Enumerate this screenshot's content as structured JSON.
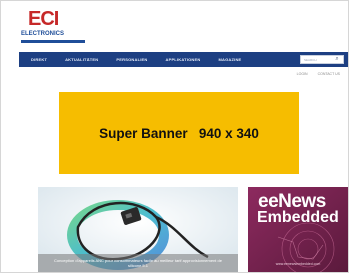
{
  "header": {
    "logo_main": "ECI",
    "logo_sub": "ELECTRONICS"
  },
  "nav": {
    "items": [
      {
        "label": "DIREKT"
      },
      {
        "label": "AKTUALITÄTEN"
      },
      {
        "label": "PERSONALIEN"
      },
      {
        "label": "APPLIKATIONEN"
      },
      {
        "label": "MAGAZINE"
      }
    ],
    "search_placeholder": "SEARCH"
  },
  "subnav": {
    "items": [
      {
        "label": "LOGIN"
      },
      {
        "label": "CONTACT US"
      }
    ]
  },
  "banner": {
    "text": "Super Banner   940 x 340"
  },
  "cards": {
    "left_caption": "Conception d'appareils ANC pour consommateurs facile au meilleur tarif approvisionnement de silicone 5.1",
    "right_title_line1": "eeNews",
    "right_title_line2": "Embedded",
    "right_url": "www.eenewsembedded.com"
  },
  "colors": {
    "nav_bg": "#1d3f82",
    "banner_bg": "#f6bd00",
    "logo_red": "#c62828",
    "logo_blue": "#1f4e99",
    "card_right_bg": "#7a2352"
  }
}
